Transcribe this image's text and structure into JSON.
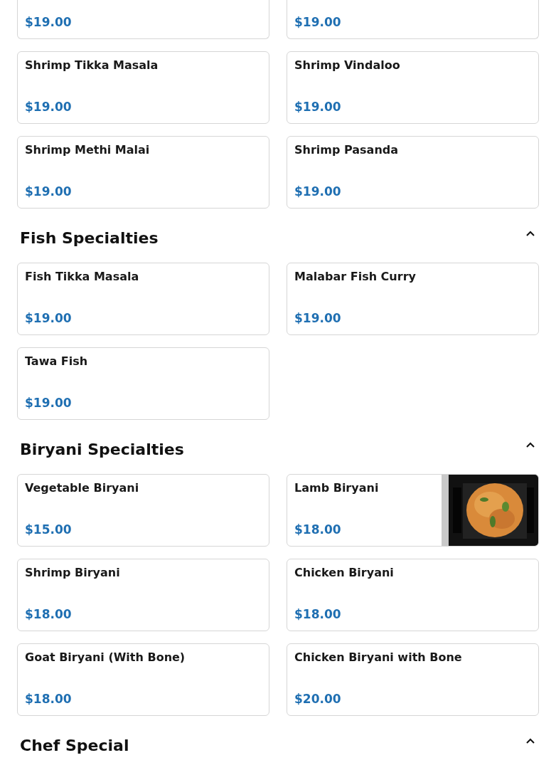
{
  "sections": [
    {
      "items": [
        {
          "price": "$19.00",
          "cut_top": true
        },
        {
          "price": "$19.00",
          "cut_top": true
        },
        {
          "name": "Shrimp Tikka Masala",
          "price": "$19.00"
        },
        {
          "name": "Shrimp Vindaloo",
          "price": "$19.00"
        },
        {
          "name": "Shrimp Methi Malai",
          "price": "$19.00"
        },
        {
          "name": "Shrimp Pasanda",
          "price": "$19.00"
        }
      ]
    },
    {
      "title": "Fish Specialties",
      "expanded": true,
      "items": [
        {
          "name": "Fish Tikka Masala",
          "price": "$19.00"
        },
        {
          "name": "Malabar Fish Curry",
          "price": "$19.00"
        },
        {
          "name": "Tawa Fish",
          "price": "$19.00"
        }
      ]
    },
    {
      "title": "Biryani Specialties",
      "expanded": true,
      "items": [
        {
          "name": "Vegetable Biryani",
          "price": "$15.00"
        },
        {
          "name": "Lamb Biryani",
          "price": "$18.00"
        },
        {
          "name": "Shrimp Biryani",
          "price": "$18.00"
        },
        {
          "name": "Chicken Biryani",
          "price": "$18.00"
        },
        {
          "name": "Goat Biryani (With Bone)",
          "price": "$18.00"
        },
        {
          "name": "Chicken Biryani with Bone",
          "price": "$20.00"
        }
      ]
    },
    {
      "title": "Chef Special",
      "expanded": true
    }
  ]
}
